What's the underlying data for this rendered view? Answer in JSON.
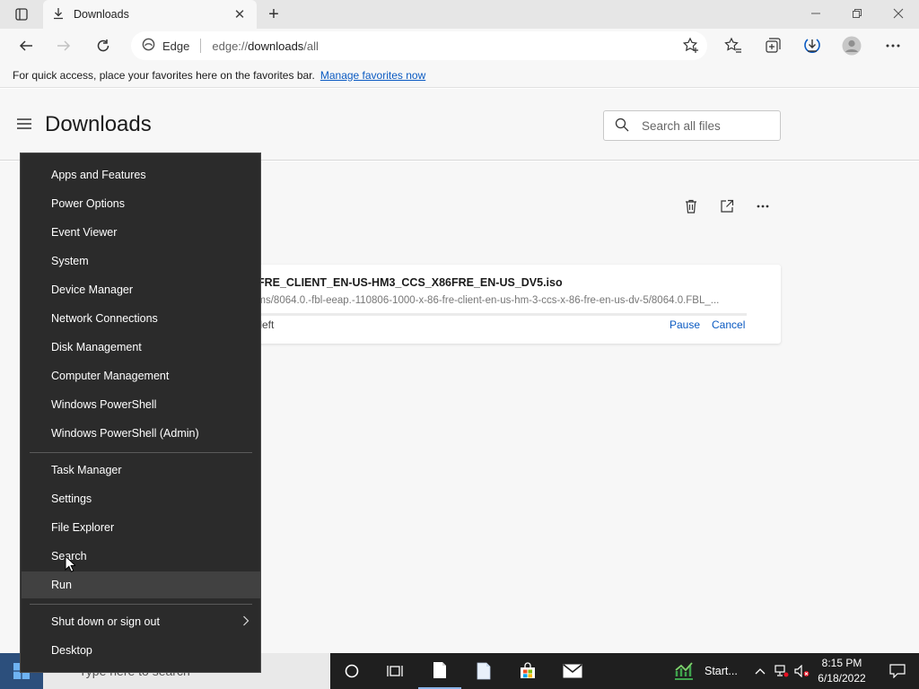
{
  "browser": {
    "tab_title": "Downloads",
    "site_name": "Edge",
    "url_prefix": "edge://",
    "url_host": "downloads",
    "url_path": "/all"
  },
  "favorites_bar": {
    "message": "For quick access, place your favorites here on the favorites bar.",
    "link": "Manage favorites now"
  },
  "downloads_page": {
    "title": "Downloads",
    "search_placeholder": "Search all files",
    "item": {
      "file_name": "6FRE_CLIENT_EN-US-HM3_CCS_X86FRE_EN-US_DV5.iso",
      "url": "ems/8064.0.-fbl-eeap.-110806-1000-x-86-fre-client-en-us-hm-3-ccs-x-86-fre-en-us-dv-5/8064.0.FBL_...",
      "status": "s left",
      "pause_label": "Pause",
      "cancel_label": "Cancel"
    }
  },
  "winx_menu": {
    "group1": [
      "Apps and Features",
      "Power Options",
      "Event Viewer",
      "System",
      "Device Manager",
      "Network Connections",
      "Disk Management",
      "Computer Management",
      "Windows PowerShell",
      "Windows PowerShell (Admin)"
    ],
    "group2": [
      "Task Manager",
      "Settings",
      "File Explorer",
      "Search",
      "Run"
    ],
    "group3": [
      "Shut down or sign out",
      "Desktop"
    ],
    "highlighted": "Run"
  },
  "taskbar": {
    "search_placeholder": "Type here to search",
    "pinned_app_label": "Start...",
    "time": "8:15 PM",
    "date": "6/18/2022"
  },
  "colors": {
    "accent": "#0a5ac2",
    "menu_bg": "#2b2b2b",
    "menu_highlight": "#414141",
    "taskbar_bg": "#1f1f1f"
  }
}
